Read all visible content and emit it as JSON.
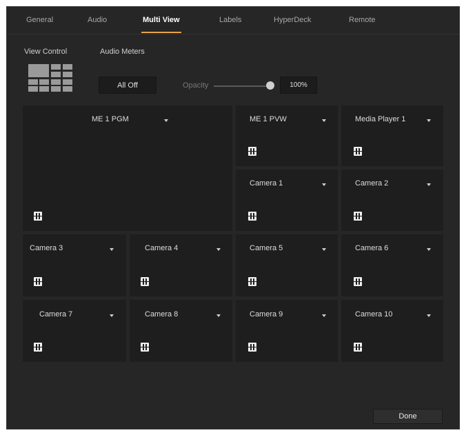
{
  "tabs": [
    "General",
    "Audio",
    "Multi View",
    "Labels",
    "HyperDeck",
    "Remote"
  ],
  "active_tab": "Multi View",
  "view_control_label": "View Control",
  "audio_meters_label": "Audio Meters",
  "all_off_label": "All Off",
  "opacity_label": "Opacity",
  "opacity_value": "100%",
  "opacity_level": 1.0,
  "done_label": "Done",
  "views": {
    "v1": "ME 1 PGM",
    "v2": "ME 1 PVW",
    "v3": "Media Player 1",
    "v4": "Camera 1",
    "v5": "Camera 2",
    "v6": "Camera 3",
    "v7": "Camera 4",
    "v8": "Camera 5",
    "v9": "Camera 6",
    "v10": "Camera 7",
    "v11": "Camera 8",
    "v12": "Camera 9",
    "v13": "Camera 10"
  },
  "icons": {
    "dropdown": "chevron-down-icon",
    "audio": "audio-meter-icon",
    "layout": "multiview-layout-icon"
  },
  "colors": {
    "background": "#262626",
    "panel": "#1e1e1e",
    "accent": "#e8a34a"
  }
}
